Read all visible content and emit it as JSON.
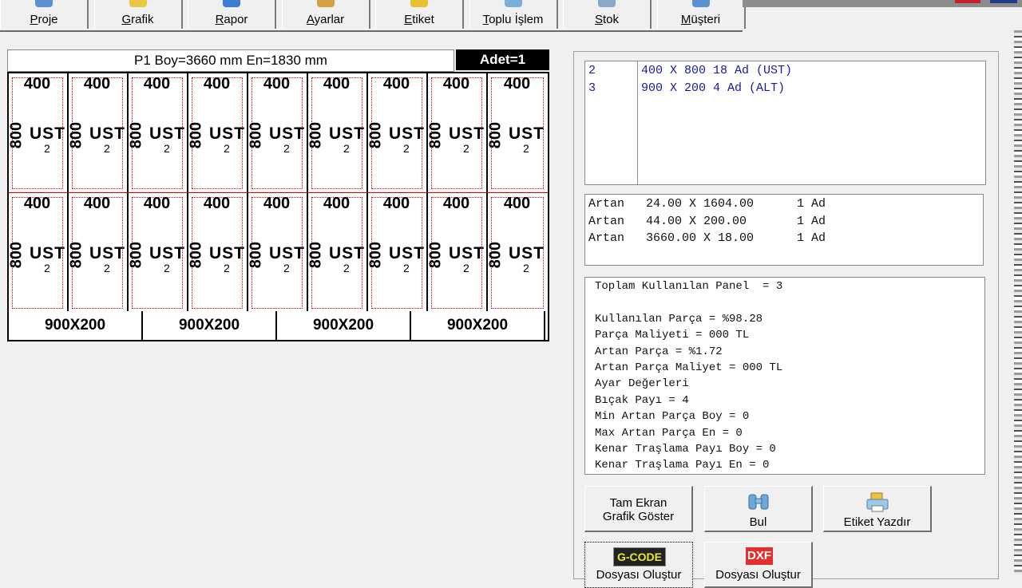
{
  "toolbar": {
    "buttons": [
      {
        "label": "Proje",
        "color": "#5b8fd4"
      },
      {
        "label": "Grafik",
        "color": "#e8c840"
      },
      {
        "label": "Rapor",
        "color": "#3c7dd1"
      },
      {
        "label": "Ayarlar",
        "color": "#d4a040"
      },
      {
        "label": "Etiket",
        "color": "#e8c030"
      },
      {
        "label": "Toplu İşlem",
        "color": "#7ab0d8"
      },
      {
        "label": "Stok",
        "color": "#8aa8c8"
      },
      {
        "label": "Müşteri",
        "color": "#5890d0"
      }
    ]
  },
  "layout_panel": {
    "title": "P1  Boy=3660 mm  En=1830 mm",
    "adet": "Adet=1",
    "piece": {
      "width": "400",
      "height": "800",
      "label": "UST",
      "index": "2"
    },
    "rows": 2,
    "cols": 9,
    "strips": [
      "900X200",
      "900X200",
      "900X200",
      "900X200"
    ],
    "colors": {
      "cut_line": "#d40000",
      "header_bg": "#000000"
    }
  },
  "parts_list": {
    "rows": [
      {
        "id": "2",
        "desc": "400 X 800 18 Ad (UST)"
      },
      {
        "id": "3",
        "desc": "900 X 200 4 Ad (ALT)"
      }
    ]
  },
  "remnants": {
    "rows": [
      "Artan   24.00 X 1604.00      1 Ad",
      "Artan   44.00 X 200.00       1 Ad",
      "Artan   3660.00 X 18.00      1 Ad"
    ]
  },
  "summary": {
    "lines": [
      "Toplam Kullanılan Panel  = 3",
      "",
      "Kullanılan Parça = %98.28",
      "Parça Maliyeti = 000 TL",
      "Artan Parça = %1.72",
      "Artan Parça Maliyet = 000 TL",
      "Ayar Değerleri",
      "Bıçak Payı = 4",
      "Min Artan Parça Boy = 0",
      "Max Artan Parça En = 0",
      "Kenar Traşlama Payı Boy = 0",
      "Kenar Traşlama Payı En = 0"
    ]
  },
  "buttons": {
    "fullscreen_line1": "Tam Ekran",
    "fullscreen_line2": "Grafik Göster",
    "find": "Bul",
    "print_label": "Etiket Yazdır",
    "gcode_badge": "G-CODE",
    "dxf_badge": "DXF",
    "gcode_label": "Dosyası Oluştur",
    "dxf_label": "Dosyası Oluştur"
  }
}
